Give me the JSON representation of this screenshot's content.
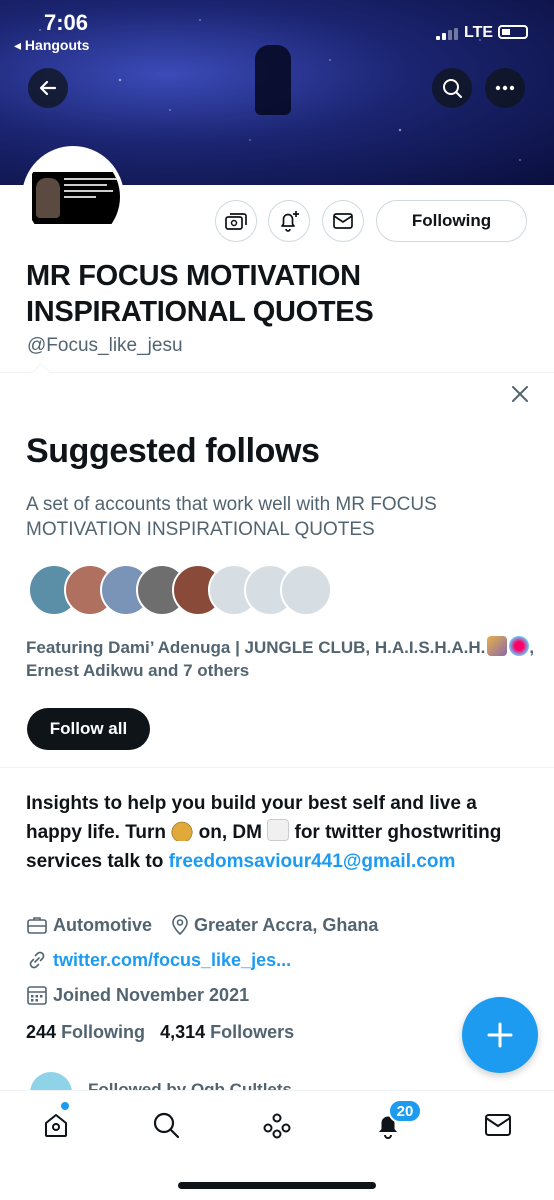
{
  "status_bar": {
    "time": "7:06",
    "back_app": "◂ Hangouts",
    "network": "LTE"
  },
  "header": {
    "back_icon": "arrow-left-icon",
    "search_icon": "search-icon",
    "more_icon": "more-horizontal-icon"
  },
  "profile": {
    "display_name": "MR FOCUS MOTIVATION INSPIRATIONAL QUOTES",
    "handle": "@Focus_like_jesu",
    "following_button": "Following",
    "bio_part1": "Insights to help you build your best self and live a happy life. Turn ",
    "bio_part2": " on, DM ",
    "bio_part3": " for twitter ghostwriting services talk to ",
    "bio_email": "freedomsaviour441@gmail.com",
    "category": "Automotive",
    "location": "Greater Accra, Ghana",
    "website": "twitter.com/focus_like_jes...",
    "joined": "Joined November 2021",
    "following_count": "244",
    "following_label": "Following",
    "followers_count": "4,314",
    "followers_label": "Followers",
    "followed_by": "Followed by Ogb Cultlets"
  },
  "suggested": {
    "title": "Suggested follows",
    "description": "A set of accounts that work well with MR FOCUS MOTIVATION INSPIRATIONAL QUOTES",
    "featuring": "Featuring Dami’ Adenuga | JUNGLE CLUB, H.A.I.S.H.A.H.",
    "featuring_tail": ", Ernest Adikwu and 7 others",
    "follow_all": "Follow all"
  },
  "tabbar": {
    "notification_count": "20"
  },
  "colors": {
    "accent": "#1d9bf0",
    "text": "#0f1419",
    "secondary": "#536471"
  }
}
